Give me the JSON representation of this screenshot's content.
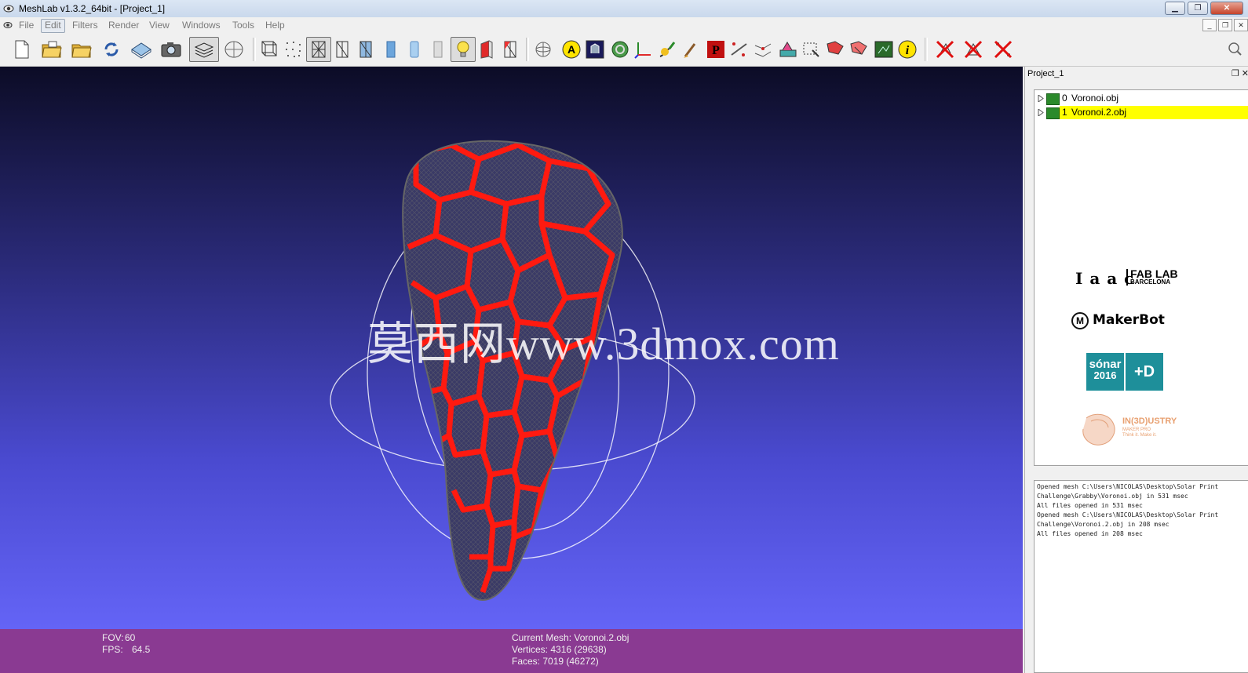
{
  "window": {
    "title": "MeshLab v1.3.2_64bit - [Project_1]"
  },
  "menu": [
    {
      "label": "File"
    },
    {
      "label": "Edit"
    },
    {
      "label": "Filters"
    },
    {
      "label": "Render"
    },
    {
      "label": "View"
    },
    {
      "label": "Windows"
    },
    {
      "label": "Tools"
    },
    {
      "label": "Help"
    }
  ],
  "toolbar_icons": [
    "new-project-icon",
    "open-project-icon",
    "open-mesh-icon",
    "reload-icon",
    "save-icon",
    "snapshot-icon",
    "layers-icon",
    "decoration-icon",
    "bbox-icon",
    "points-icon",
    "wireframe-icon",
    "hidden-lines-icon",
    "flat-lines-icon",
    "flat-icon",
    "smooth-icon",
    "texture-icon",
    "light-icon",
    "backface-icon",
    "selected-faces-icon",
    "trackball-icon",
    "annotation-icon",
    "info-board-icon",
    "color-icon",
    "axes-icon",
    "paint-icon",
    "brush-icon",
    "pick-points-icon",
    "measure-icon",
    "align-icon",
    "texture-paint-icon",
    "select-vertices-icon",
    "select-faces-icon",
    "connected-select-icon",
    "raster-icon",
    "info-icon",
    "delete-faces-icon",
    "delete-vertices-icon",
    "delete-all-icon"
  ],
  "viewport": {
    "watermark": "莫西网www.3dmox.com",
    "fov_label": "FOV:",
    "fov_value": "60",
    "fps_label": "FPS:",
    "fps_value": "64.5",
    "current_mesh": "Current Mesh: Voronoi.2.obj",
    "vertices": "Vertices: 4316 (29638)",
    "faces": "Faces: 7019 (46272)"
  },
  "panel": {
    "title": "Project_1",
    "layers": [
      {
        "index": "0",
        "name": "Voronoi.obj",
        "selected": false
      },
      {
        "index": "1",
        "name": "Voronoi.2.obj",
        "selected": true
      }
    ],
    "logos": {
      "iaac": "I a a c",
      "fablab": "FAB LAB",
      "barcelona": "BARCELONA",
      "makerbot": "MakerBot",
      "sonar": "sónar",
      "sonar_year": "2016",
      "plus_d": "+D",
      "industry": "IN(3D)USTRY",
      "industry_sub": "MAKER PRO",
      "industry_sub2": "Think it. Make it."
    },
    "log": [
      "Opened mesh C:\\Users\\NICOLAS\\Desktop\\Solar Print",
      "Challenge\\Grabby\\Voronoi.obj in 531 msec",
      "All files opened in 531 msec",
      "Opened mesh C:\\Users\\NICOLAS\\Desktop\\Solar Print",
      "Challenge\\Voronoi.2.obj in 208 msec",
      "All files opened in 208 msec"
    ]
  },
  "colors": {
    "mesh_red": "#ff1a10",
    "status_bg": "#8a3a92",
    "selection": "#ffff00"
  }
}
